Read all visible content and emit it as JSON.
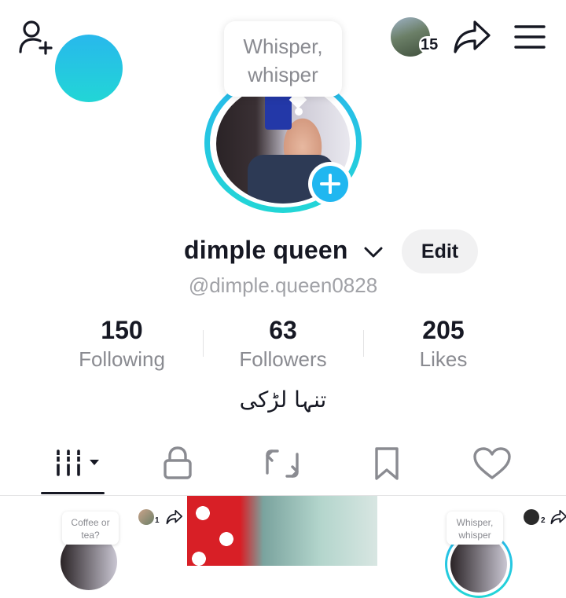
{
  "header": {
    "add_friend_icon": "add-user-icon",
    "friends_count": "15",
    "share_icon": "share-icon",
    "menu_icon": "menu-icon"
  },
  "story_bubble": "Whisper, whisper",
  "profile": {
    "name": "dimple queen",
    "handle": "@dimple.queen0828",
    "edit_label": "Edit",
    "bio": "تنہا لڑکی"
  },
  "stats": [
    {
      "value": "150",
      "label": "Following"
    },
    {
      "value": "63",
      "label": "Followers"
    },
    {
      "value": "205",
      "label": "Likes"
    }
  ],
  "tabs": [
    {
      "name": "videos",
      "icon": "grid-icon",
      "active": true
    },
    {
      "name": "private",
      "icon": "lock-icon"
    },
    {
      "name": "reposts",
      "icon": "repost-icon"
    },
    {
      "name": "favorites",
      "icon": "bookmark-icon"
    },
    {
      "name": "liked",
      "icon": "heart-icon"
    }
  ],
  "grid": [
    {
      "bubble": "Coffee or tea?",
      "count": "1"
    },
    {
      "bubble": ""
    },
    {
      "bubble": "Whisper, whisper",
      "count": "2"
    }
  ],
  "colors": {
    "ring": "#20b7f0",
    "text": "#161823",
    "secondary": "#8a8b91"
  }
}
